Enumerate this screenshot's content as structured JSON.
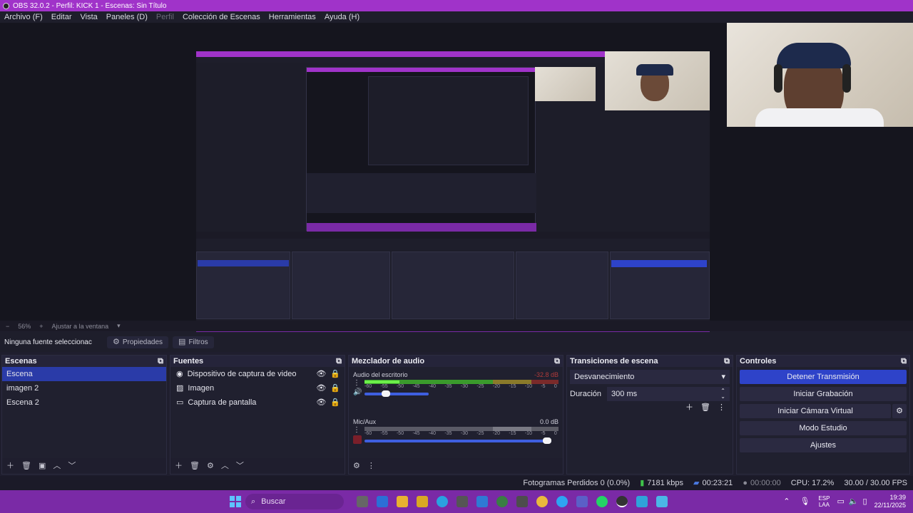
{
  "window": {
    "title": "OBS 32.0.2 - Perfil: KICK 1 - Escenas: Sin Título"
  },
  "menu": {
    "items": [
      "Archivo (F)",
      "Editar",
      "Vista",
      "Paneles (D)",
      "Perfil",
      "Colección de Escenas",
      "Herramientas",
      "Ayuda (H)"
    ]
  },
  "zoom": {
    "minus": "−",
    "level": "56%",
    "plus": "+",
    "fit": "Ajustar a la ventana"
  },
  "source_toolbar": {
    "no_source": "Ninguna fuente seleccionac",
    "properties": "Propiedades",
    "filters": "Filtros"
  },
  "scenes": {
    "title": "Escenas",
    "items": [
      {
        "label": "Escena",
        "selected": true
      },
      {
        "label": "imagen 2",
        "selected": false
      },
      {
        "label": "Escena 2",
        "selected": false
      }
    ]
  },
  "sources": {
    "title": "Fuentes",
    "items": [
      {
        "label": "Dispositivo de captura de video",
        "icon": "camera-icon"
      },
      {
        "label": "Imagen",
        "icon": "image-icon"
      },
      {
        "label": "Captura de pantalla",
        "icon": "monitor-icon"
      }
    ]
  },
  "mixer": {
    "title": "Mezclador de audio",
    "channels": [
      {
        "name": "Audio del escritorio",
        "level": "-32.8 dB",
        "volume": 0.4,
        "meter": 0.18
      },
      {
        "name": "Mic/Aux",
        "level": "0.0 dB",
        "volume": 1.0,
        "meter": 0.0
      }
    ],
    "ticks": [
      "-60",
      "-55",
      "-50",
      "-45",
      "-40",
      "-35",
      "-30",
      "-25",
      "-20",
      "-15",
      "-10",
      "-5",
      "0"
    ]
  },
  "transitions": {
    "title": "Transiciones de escena",
    "type": "Desvanecimiento",
    "duration_label": "Duración",
    "duration_value": "300 ms"
  },
  "controls": {
    "title": "Controles",
    "buttons": [
      "Detener Transmisión",
      "Iniciar Grabación",
      "Iniciar Cámara Virtual",
      "Modo Estudio",
      "Ajustes"
    ]
  },
  "status": {
    "dropped": "Fotogramas Perdidos 0 (0.0%)",
    "bitrate": "7181 kbps",
    "stream_time": "00:23:21",
    "rec_time": "00:00:00",
    "cpu": "CPU: 17.2%",
    "fps": "30.00 / 30.00 FPS"
  },
  "taskbar": {
    "search": "Buscar",
    "lang": "ESP",
    "lang2": "LAA",
    "time": "19:39",
    "date": "22/11/2025"
  },
  "colors": {
    "accent": "#a033c9",
    "selection": "#2a3ba8",
    "primary_button": "#2e43c9",
    "taskbar": "#7a2aa6"
  }
}
